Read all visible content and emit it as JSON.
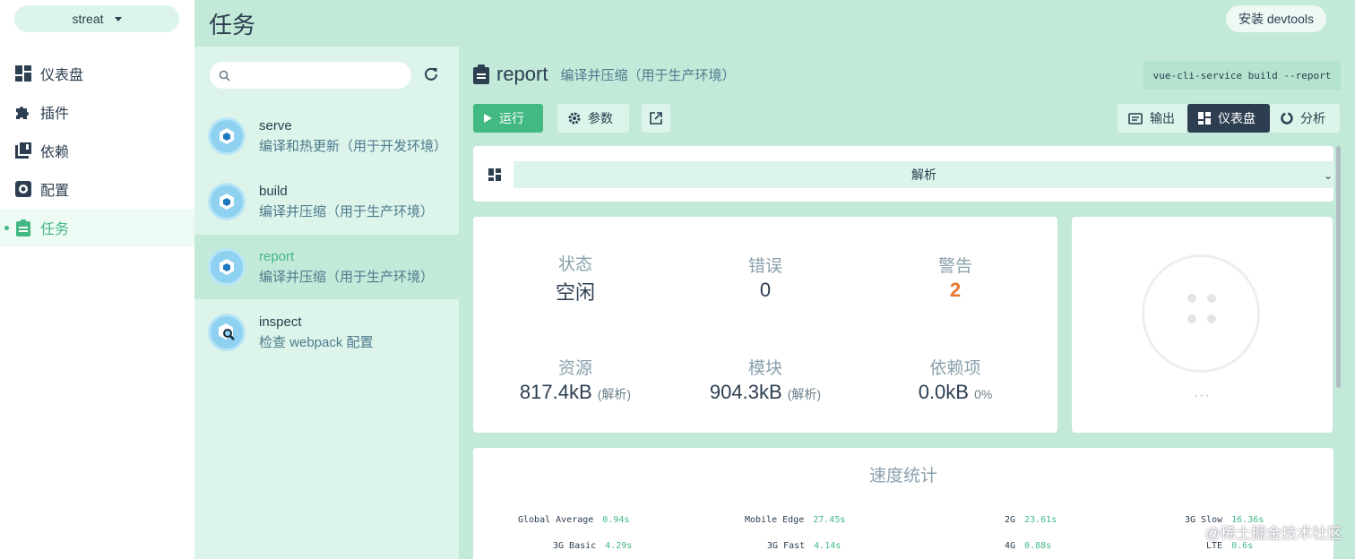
{
  "project": {
    "name": "streat"
  },
  "nav": {
    "items": [
      {
        "label": "仪表盘",
        "icon": "dashboard-icon"
      },
      {
        "label": "插件",
        "icon": "puzzle-icon"
      },
      {
        "label": "依赖",
        "icon": "library-icon"
      },
      {
        "label": "配置",
        "icon": "settings-icon"
      },
      {
        "label": "任务",
        "icon": "clipboard-icon",
        "active": true
      }
    ]
  },
  "header": {
    "title": "任务",
    "devtools_label": "安装 devtools"
  },
  "search": {
    "placeholder": ""
  },
  "tasks": [
    {
      "name": "serve",
      "description": "编译和热更新（用于开发环境）"
    },
    {
      "name": "build",
      "description": "编译并压缩（用于生产环境）"
    },
    {
      "name": "report",
      "description": "编译并压缩（用于生产环境）",
      "active": true
    },
    {
      "name": "inspect",
      "description": "检查 webpack 配置"
    }
  ],
  "current_task": {
    "name": "report",
    "description": "编译并压缩（用于生产环境）",
    "command": "vue-cli-service build --report"
  },
  "toolbar": {
    "run_label": "运行",
    "params_label": "参数",
    "output_label": "输出",
    "dashboard_label": "仪表盘",
    "analyze_label": "分析"
  },
  "parse_select": {
    "value": "解析"
  },
  "stats": {
    "status": {
      "label": "状态",
      "value": "空闲"
    },
    "errors": {
      "label": "错误",
      "value": "0"
    },
    "warnings": {
      "label": "警告",
      "value": "2"
    },
    "assets": {
      "label": "资源",
      "value": "817.4kB",
      "note": "(解析)"
    },
    "modules": {
      "label": "模块",
      "value": "904.3kB",
      "note": "(解析)"
    },
    "deps": {
      "label": "依赖项",
      "value": "0.0kB",
      "note": "0%"
    }
  },
  "donut": {
    "more_label": "···"
  },
  "speed": {
    "title": "速度统计",
    "rows": [
      {
        "label": "Global Average",
        "value": "0.94s"
      },
      {
        "label": "Mobile Edge",
        "value": "27.45s"
      },
      {
        "label": "2G",
        "value": "23.61s"
      },
      {
        "label": "3G Slow",
        "value": "16.36s"
      },
      {
        "label": "3G Basic",
        "value": "4.29s"
      },
      {
        "label": "3G Fast",
        "value": "4.14s"
      },
      {
        "label": "4G",
        "value": "0.88s"
      },
      {
        "label": "LTE",
        "value": "0.6s"
      }
    ]
  },
  "watermark": "@稀土掘金技术社区",
  "colors": {
    "accent": "#42b983",
    "dark": "#2c3e50",
    "panel": "#c3e9d9",
    "panel_light": "#dcf4ea",
    "warning": "#e8772e"
  }
}
